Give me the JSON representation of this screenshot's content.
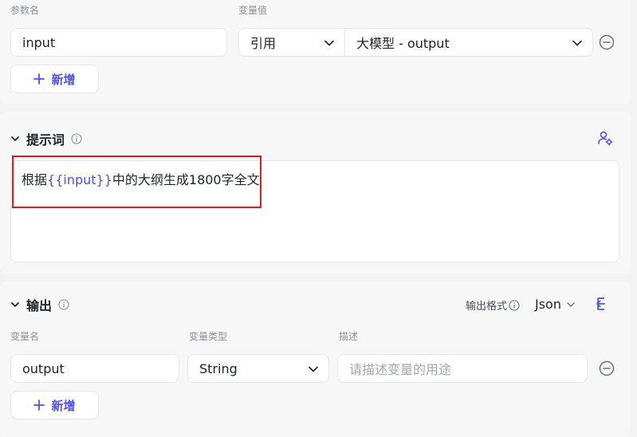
{
  "input_section": {
    "param_name_label": "参数名",
    "var_value_label": "变量值",
    "param_name_value": "input",
    "ref_type": "引用",
    "ref_value": "大模型 - output",
    "add_label": "新增"
  },
  "prompt_section": {
    "title": "提示词",
    "prompt_prefix": "根据",
    "prompt_var": "{{input}}",
    "prompt_suffix": "中的大纲生成1800字全文"
  },
  "output_section": {
    "title": "输出",
    "format_label": "输出格式",
    "format_value": "Json",
    "var_name_label": "变量名",
    "var_type_label": "变量类型",
    "desc_label": "描述",
    "var_name_value": "output",
    "var_type_value": "String",
    "desc_placeholder": "请描述变量的用途",
    "add_label": "新增"
  },
  "colors": {
    "accent": "#4d53e8",
    "highlight": "#d81e1e"
  }
}
